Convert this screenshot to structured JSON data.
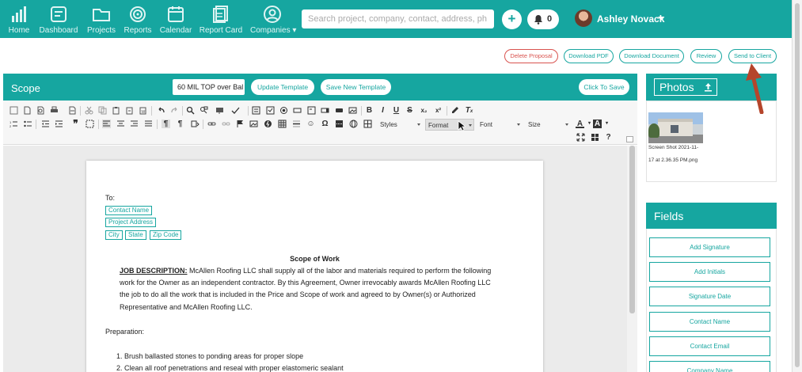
{
  "nav": {
    "items": [
      {
        "label": "Home",
        "icon": "chart-icon"
      },
      {
        "label": "Dashboard",
        "icon": "dashboard-icon"
      },
      {
        "label": "Projects",
        "icon": "folder-icon"
      },
      {
        "label": "Reports",
        "icon": "target-icon"
      },
      {
        "label": "Calendar",
        "icon": "calendar-icon"
      },
      {
        "label": "Report Card",
        "icon": "report-card-icon"
      },
      {
        "label": "Companies",
        "icon": "user-circle-icon"
      }
    ],
    "search_placeholder": "Search project, company, contact, address, ph",
    "plus_label": "+",
    "notification_count": "0",
    "user_name": "Ashley Novack",
    "brand_color": "#16a6a0"
  },
  "actions": {
    "delete": "Delete Proposal",
    "download_pdf": "Download PDF",
    "download_doc": "Download Document",
    "review": "Review",
    "send": "Send to Client"
  },
  "scope": {
    "title": "Scope",
    "template_value": "60 MIL TOP over Bal",
    "update_template": "Update Template",
    "save_new_template": "Save New Template",
    "click_to_save": "Click To Save"
  },
  "toolbar": {
    "styles": "Styles",
    "format": "Format",
    "font": "Font",
    "size": "Size"
  },
  "document": {
    "to": "To:",
    "tags": {
      "contact_name": "Contact Name",
      "project_address": "Project Address",
      "city": "City",
      "state": "State",
      "zip": "Zip Code"
    },
    "heading": "Scope of Work",
    "job_label": "JOB DESCRIPTION:",
    "job_line1": "McAllen Roofing LLC shall supply all of the labor and materials required to perform the following",
    "job_line2": "work for the Owner as an independent contractor. By this Agreement, Owner irrevocably awards McAllen Roofing LLC",
    "job_line3": "the job to do all the work that is included in the Price and Scope of work and agreed to by Owner(s) or Authorized",
    "job_line4": "Representative and McAllen Roofing LLC.",
    "preparation": "Preparation:",
    "list": [
      "1.  Brush ballasted stones to ponding areas for proper slope",
      "2.  Clean all roof penetrations and reseal with proper elastomeric sealant"
    ]
  },
  "photos": {
    "title": "Photos",
    "caption_line1": "Screen Shot 2021-11-",
    "caption_line2": "17 at 2.36.35 PM.png"
  },
  "fields": {
    "title": "Fields",
    "buttons": [
      "Add Signature",
      "Add Initials",
      "Signature Date",
      "Contact Name",
      "Contact Email",
      "Company Name"
    ]
  },
  "annotation": {
    "arrow_color": "#b5452b"
  }
}
